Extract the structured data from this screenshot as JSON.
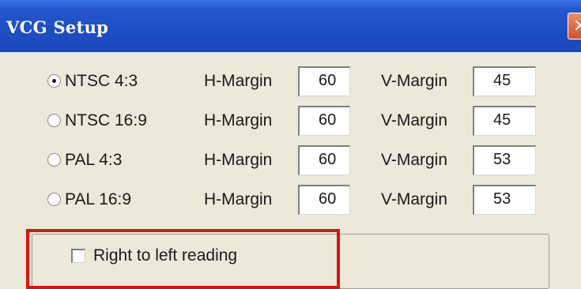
{
  "window": {
    "title": "VCG Setup",
    "close_icon": "close-icon"
  },
  "rows": [
    {
      "mode": "NTSC 4:3",
      "selected": true,
      "h_label": "H-Margin",
      "h_value": "60",
      "v_label": "V-Margin",
      "v_value": "45"
    },
    {
      "mode": "NTSC 16:9",
      "selected": false,
      "h_label": "H-Margin",
      "h_value": "60",
      "v_label": "V-Margin",
      "v_value": "45"
    },
    {
      "mode": "PAL 4:3",
      "selected": false,
      "h_label": "H-Margin",
      "h_value": "60",
      "v_label": "V-Margin",
      "v_value": "53"
    },
    {
      "mode": "PAL 16:9",
      "selected": false,
      "h_label": "H-Margin",
      "h_value": "60",
      "v_label": "V-Margin",
      "v_value": "53"
    }
  ],
  "options": {
    "rtl_label": "Right to left reading",
    "rtl_checked": false
  },
  "colors": {
    "titlebar": "#1d4fc6",
    "dialog_bg": "#ece9d8",
    "highlight": "#e01010"
  }
}
